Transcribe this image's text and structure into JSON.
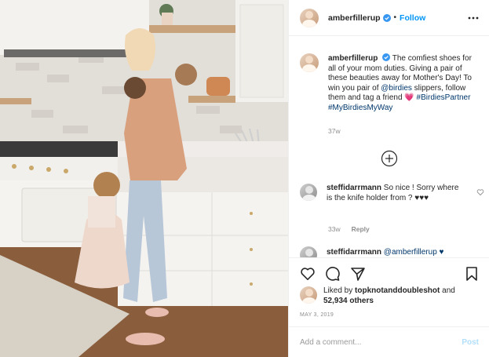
{
  "post": {
    "username": "amberfillerup",
    "follow_label": "Follow",
    "separator": "•",
    "icons": {
      "verified": "verified-badge-icon",
      "more": "more-options-icon",
      "load_more": "plus-circle-icon",
      "like": "heart-icon",
      "comment": "comment-icon",
      "share": "send-icon",
      "save": "bookmark-icon",
      "comment_like": "small-heart-icon"
    },
    "colors": {
      "accent": "#0095f6",
      "verified": "#3897f0",
      "link": "#00376b",
      "muted": "#8e8e8e"
    }
  },
  "caption": {
    "username": "amberfillerup",
    "text_1": "The comfiest shoes for all of your mom duties. Giving a pair of these beauties away for Mother's Day! To win you pair of ",
    "mention": "@birdies",
    "text_2": " slippers, follow them and tag a friend ",
    "emoji": "💗",
    "hashtag_1": "#BirdiesPartner",
    "hashtag_2": "#MyBirdiesMyWay",
    "time": "37w"
  },
  "comments": [
    {
      "username": "steffidarrmann",
      "text": "So nice ! Sorry where is the knife holder from ? ♥♥♥",
      "time": "33w",
      "reply_label": "Reply"
    },
    {
      "username": "steffidarrmann",
      "text": "@amberfillerup ♥"
    }
  ],
  "likes": {
    "prefix": "Liked by ",
    "user": "topknotanddoubleshot",
    "middle": " and",
    "count": "52,934 others"
  },
  "date": "MAY 3, 2019",
  "add_comment": {
    "placeholder": "Add a comment...",
    "post_label": "Post"
  }
}
